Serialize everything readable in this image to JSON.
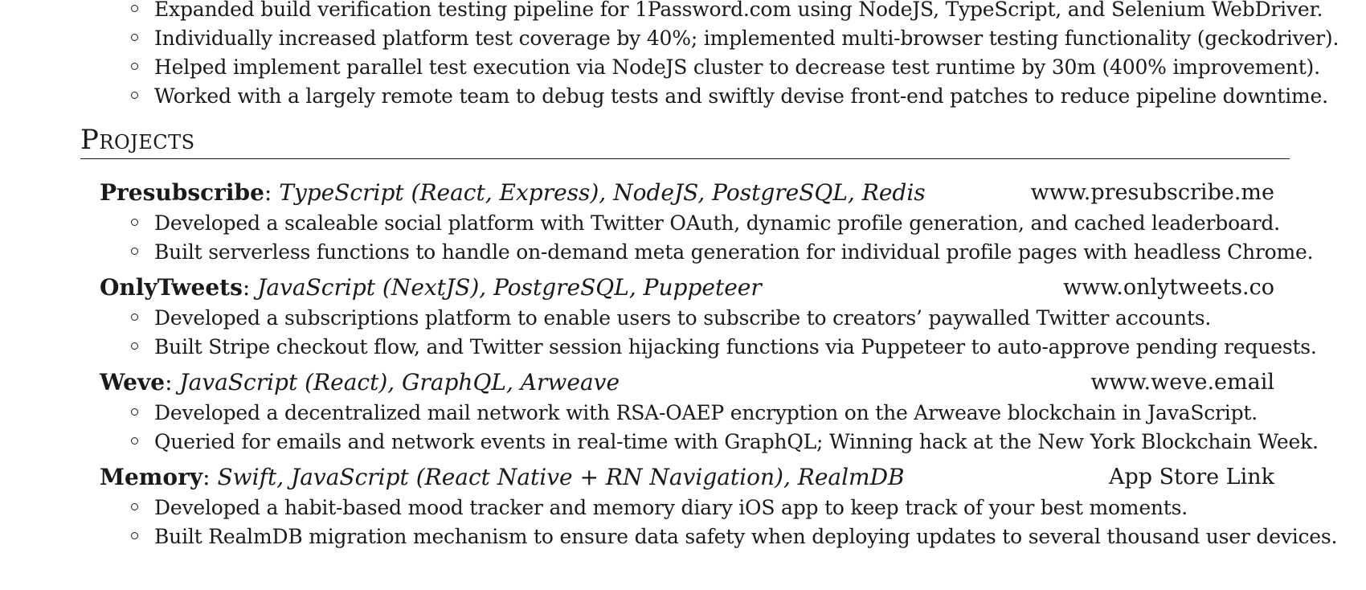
{
  "experience_bullets": [
    "Expanded build verification testing pipeline for 1Password.com using NodeJS, TypeScript, and Selenium WebDriver.",
    "Individually increased platform test coverage by 40%; implemented multi-browser testing functionality (geckodriver).",
    "Helped implement parallel test execution via NodeJS cluster to decrease test runtime by 30m (400% improvement).",
    "Worked with a largely remote team to debug tests and swiftly devise front-end patches to reduce pipeline downtime."
  ],
  "projects_section": {
    "title": "Projects",
    "items": [
      {
        "name": "Presubscribe",
        "separator": ": ",
        "stack": "TypeScript (React, Express), NodeJS, PostgreSQL, Redis",
        "link": "www.presubscribe.me",
        "bullets": [
          "Developed a scaleable social platform with Twitter OAuth, dynamic profile generation, and cached leaderboard.",
          "Built serverless functions to handle on-demand meta generation for individual profile pages with headless Chrome."
        ]
      },
      {
        "name": "OnlyTweets",
        "separator": ": ",
        "stack": "JavaScript (NextJS), PostgreSQL, Puppeteer",
        "link": "www.onlytweets.co",
        "bullets": [
          "Developed a subscriptions platform to enable users to subscribe to creators’ paywalled Twitter accounts.",
          "Built Stripe checkout flow, and Twitter session hijacking functions via Puppeteer to auto-approve pending requests."
        ]
      },
      {
        "name": "Weve",
        "separator": ": ",
        "stack": "JavaScript (React), GraphQL, Arweave",
        "link": "www.weve.email",
        "bullets": [
          "Developed a decentralized mail network with RSA-OAEP encryption on the Arweave blockchain in JavaScript.",
          "Queried for emails and network events in real-time with GraphQL; Winning hack at the New York Blockchain Week."
        ]
      },
      {
        "name": "Memory",
        "separator": ": ",
        "stack": "Swift, JavaScript (React Native + RN Navigation), RealmDB",
        "link": "App Store Link",
        "bullets": [
          "Developed a habit-based mood tracker and memory diary iOS app to keep track of your best moments.",
          "Built RealmDB migration mechanism to ensure data safety when deploying updates to several thousand user devices."
        ]
      }
    ]
  }
}
